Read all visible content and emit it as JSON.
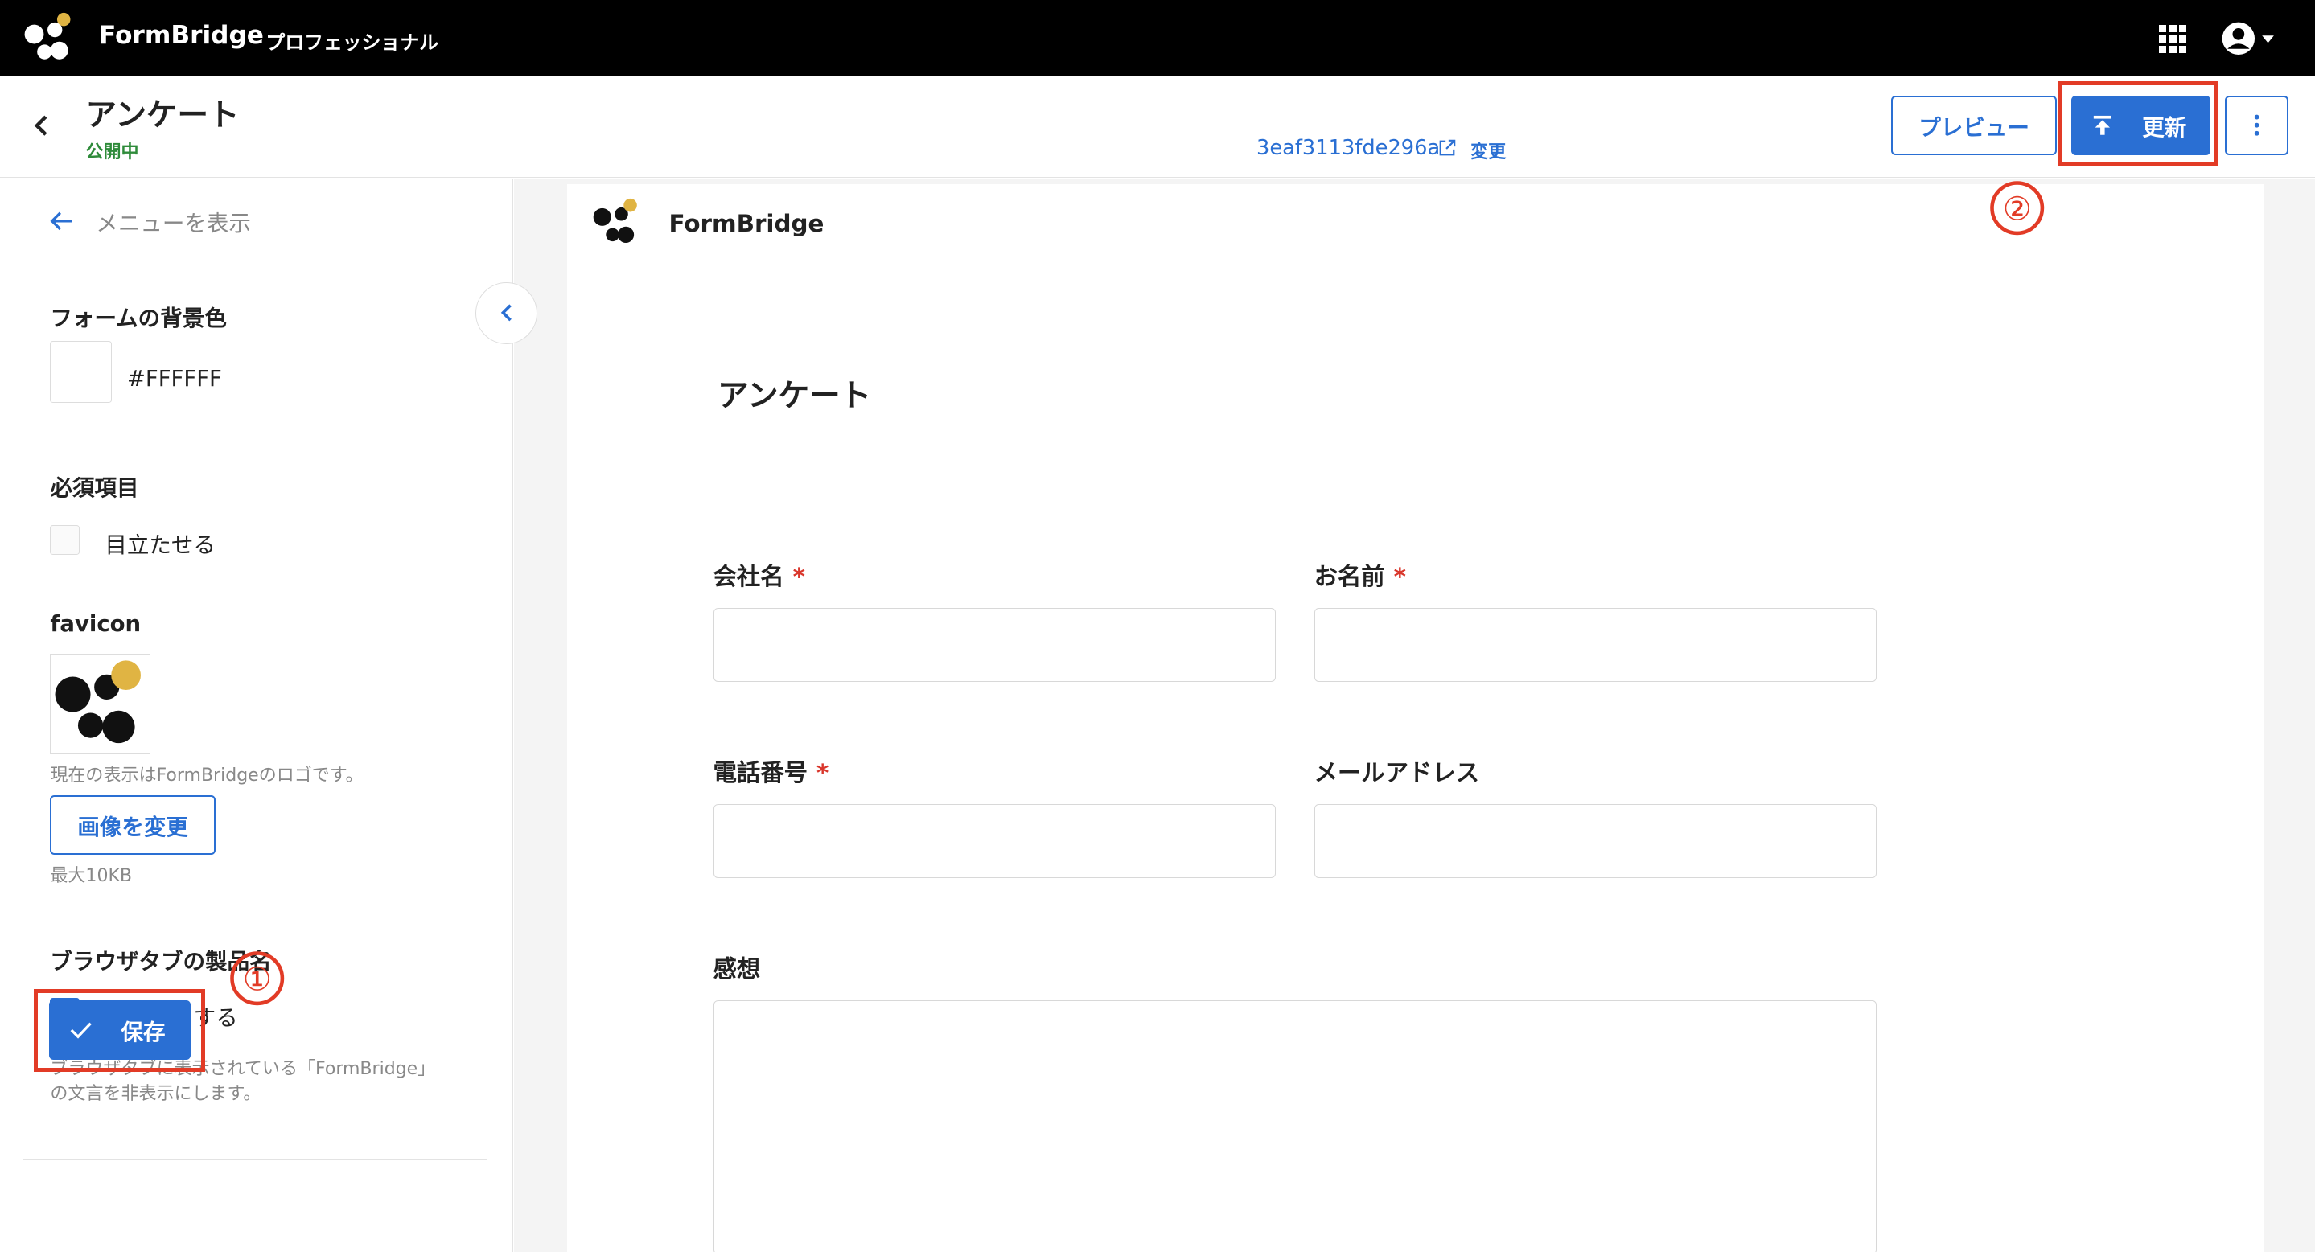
{
  "topbar": {
    "brand": "FormBridge",
    "plan": "プロフェッショナル"
  },
  "header": {
    "title": "アンケート",
    "status": "公開中",
    "form_id": "3eaf3113fde296a",
    "change_label": "変更",
    "preview_label": "プレビュー",
    "update_label": "更新",
    "annotation_update": "②"
  },
  "sidebar": {
    "show_menu_label": "メニューを表示",
    "bg_color_heading": "フォームの背景色",
    "bg_color_value": "#FFFFFF",
    "required_heading": "必須項目",
    "required_option_label": "目立たせる",
    "required_option_checked": false,
    "favicon_heading": "favicon",
    "favicon_hint": "現在の表示はFormBridgeのロゴです。",
    "change_image_label": "画像を変更",
    "max_size_hint": "最大10KB",
    "tab_name_heading": "ブラウザタブの製品名",
    "hide_option_label": "非表示にする",
    "hide_option_checked": true,
    "hide_hint_line1": "ブラウザタブに表示されている「FormBridge」",
    "hide_hint_line2": "の文言を非表示にします。",
    "annotation_save": "①",
    "save_label": "保存"
  },
  "form": {
    "brand": "FormBridge",
    "title": "アンケート",
    "required_mark": "*",
    "fields": [
      {
        "label": "会社名",
        "required": true
      },
      {
        "label": "お名前",
        "required": true
      },
      {
        "label": "電話番号",
        "required": true
      },
      {
        "label": "メールアドレス",
        "required": false
      },
      {
        "label": "感想",
        "required": false
      }
    ]
  },
  "colors": {
    "topbar": "#000000",
    "accent": "#2a6fd3",
    "status_green": "#2e8b3a",
    "annotation_red": "#e23b26",
    "logo_gold": "#e0b443"
  }
}
